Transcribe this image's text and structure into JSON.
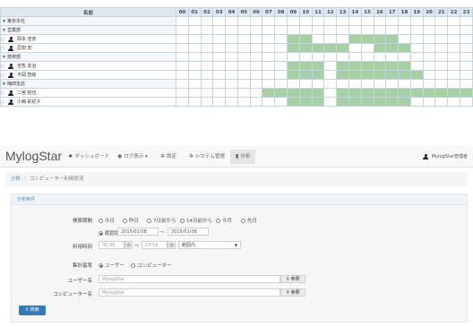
{
  "grid": {
    "name_header": "名前",
    "hours": [
      "00",
      "01",
      "02",
      "03",
      "04",
      "05",
      "06",
      "07",
      "08",
      "09",
      "10",
      "11",
      "12",
      "13",
      "14",
      "15",
      "16",
      "17",
      "18",
      "19",
      "20",
      "21",
      "22",
      "23"
    ],
    "rows": [
      {
        "level": 1,
        "kind": "group",
        "label": "東京本社",
        "busy": []
      },
      {
        "level": 2,
        "kind": "group",
        "label": "営業部",
        "busy": []
      },
      {
        "level": 3,
        "kind": "user",
        "label": "岡本 佳奈",
        "busy": [
          9,
          10,
          14,
          15,
          16,
          17
        ]
      },
      {
        "level": 3,
        "kind": "user",
        "label": "忍田 宏",
        "busy": [
          9,
          10,
          11,
          12,
          13,
          16,
          17,
          18
        ]
      },
      {
        "level": 2,
        "kind": "group",
        "label": "技術部",
        "busy": []
      },
      {
        "level": 3,
        "kind": "user",
        "label": "吉牧 友治",
        "busy": [
          9,
          10,
          11,
          13,
          14,
          15,
          16,
          17,
          18
        ]
      },
      {
        "level": 3,
        "kind": "user",
        "label": "平岡 智絵",
        "busy": [
          9,
          10,
          11,
          13,
          14,
          15,
          16,
          17,
          18,
          19
        ]
      },
      {
        "level": 1,
        "kind": "group",
        "label": "梅田支店",
        "busy": []
      },
      {
        "level": 2,
        "kind": "user",
        "label": "二宮 拓也",
        "busy": [
          7,
          8,
          9,
          10,
          11,
          13,
          14,
          15,
          16,
          17,
          18,
          19,
          20,
          21,
          22,
          23
        ]
      },
      {
        "level": 2,
        "kind": "user",
        "label": "小嶋 彩紀子",
        "busy": [
          9,
          10,
          11,
          13,
          14,
          15,
          16,
          17,
          18
        ]
      }
    ]
  },
  "navbar": {
    "brand": "MylogStar",
    "dashboard": "ダッシュボード",
    "log_view": "ログ表示 ▾",
    "settings": "設定",
    "system_admin": "システム管理",
    "analysis": "分析",
    "user": "MylogStar管理者"
  },
  "breadcrumb": {
    "root": "分析",
    "sep": "/",
    "current": "コンピューター利用状況"
  },
  "panel": {
    "heading": "分析条件",
    "period_label": "検索期間",
    "period_options": [
      "今日",
      "昨日",
      "7日前から",
      "14日前から",
      "今月",
      "先月"
    ],
    "range_label": "範囲指定",
    "date_from": "2015/01/08",
    "date_tilde": "〜",
    "date_to": "2015/01/08",
    "time_label": "利用時刻",
    "time_from": "00:00",
    "time_tilde": "〜",
    "time_to": "23:59",
    "time_mode": "範囲内",
    "agg_label": "集計基準",
    "agg_options": [
      "ユーザー",
      "コンピューター"
    ],
    "user_label": "ユーザー名",
    "user_value": "MylogStar",
    "computer_label": "コンピューター名",
    "computer_value": "MylogStar",
    "ref_label": "参照",
    "search_label": "検索"
  },
  "colors": {
    "busy": "#a6cfa4",
    "header_bg": "#dfe8f1",
    "primary": "#337ab7"
  }
}
